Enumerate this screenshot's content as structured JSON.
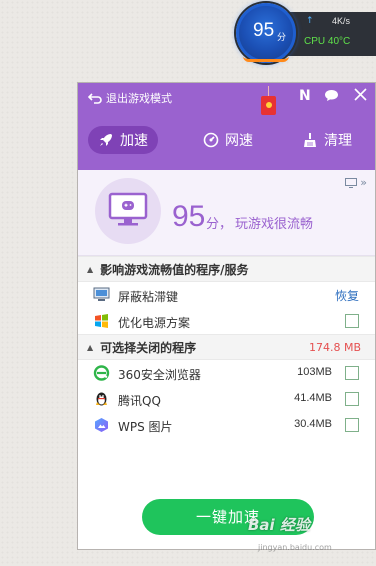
{
  "speed_ball": {
    "score": "95",
    "unit": "分",
    "upload_arrow": "↑",
    "net_speed": "4K/s",
    "cpu": "CPU 40°C"
  },
  "header": {
    "exit_label": "退出游戏模式",
    "n_label": "N",
    "tabs": [
      {
        "label": "加速",
        "icon": "rocket-icon",
        "active": true
      },
      {
        "label": "网速",
        "icon": "gauge-icon",
        "active": false
      },
      {
        "label": "清理",
        "icon": "broom-icon",
        "active": false
      }
    ]
  },
  "score": {
    "value": "95",
    "unit": "分，",
    "text": "玩游戏很流畅",
    "more": "»"
  },
  "section1": {
    "title": "影响游戏流畅值的程序/服务",
    "items": [
      {
        "label": "屏蔽粘滞键",
        "action": "恢复",
        "icon": "monitor-icon"
      },
      {
        "label": "优化电源方案",
        "icon": "windows-logo-icon",
        "checked": false
      }
    ]
  },
  "section2": {
    "title": "可选择关闭的程序",
    "total": "174.8 MB",
    "items": [
      {
        "label": "360安全浏览器",
        "size": "103MB",
        "icon": "360-browser-icon",
        "checked": false
      },
      {
        "label": "腾讯QQ",
        "size": "41.4MB",
        "icon": "qq-penguin-icon",
        "checked": false
      },
      {
        "label": "WPS 图片",
        "size": "30.4MB",
        "icon": "wps-picture-icon",
        "checked": false
      }
    ]
  },
  "accelerate_button": "一键加速",
  "watermark": {
    "main": "Bai 经验",
    "sub": "jingyan.baidu.com"
  },
  "colors": {
    "accent": "#9a62cf",
    "tab_active": "#7f42b6",
    "button": "#1fc45c",
    "total": "#e55050"
  }
}
